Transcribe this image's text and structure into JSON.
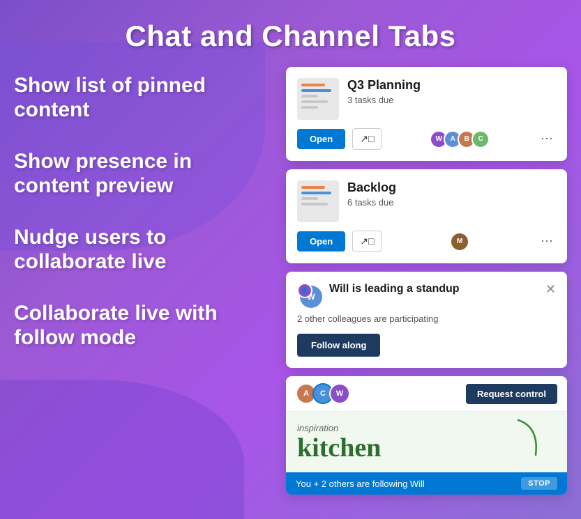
{
  "page": {
    "title": "Chat and Channel Tabs"
  },
  "features": [
    {
      "id": "pinned",
      "label": "Show list of pinned content"
    },
    {
      "id": "presence",
      "label": "Show presence in content preview"
    },
    {
      "id": "nudge",
      "label": "Nudge users to collaborate live"
    },
    {
      "id": "follow",
      "label": "Collaborate live with follow mode"
    }
  ],
  "cards": {
    "q3": {
      "title": "Q3 Planning",
      "subtitle": "3 tasks due",
      "open_label": "Open",
      "more_icon": "⋯"
    },
    "backlog": {
      "title": "Backlog",
      "subtitle": "6 tasks due",
      "open_label": "Open",
      "more_icon": "⋯"
    },
    "standup": {
      "title": "Will is leading a standup",
      "subtitle": "2 other colleagues are participating",
      "follow_label": "Follow along",
      "close_icon": "✕"
    },
    "collab": {
      "request_label": "Request control",
      "following_text": "You + 2 others are following Will",
      "stop_label": "STOP",
      "content_line1": "inspiration",
      "content_line2": "kitchen"
    }
  }
}
